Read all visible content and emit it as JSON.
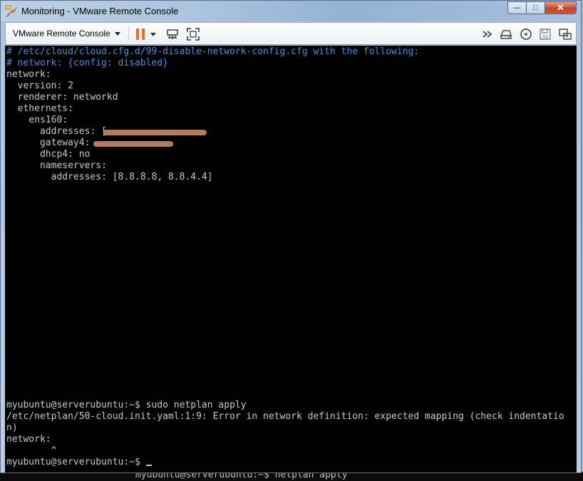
{
  "window": {
    "title": "Monitoring - VMware Remote Console",
    "controls": {
      "minimize": "—",
      "maximize": "□",
      "close": "✕"
    }
  },
  "toolbar": {
    "menu_label": "VMware Remote Console",
    "icons": [
      "pause-icon",
      "dropdown-caret-icon",
      "network-adapter-icon",
      "fullscreen-icon",
      "send-keys-icon",
      "hard-disk-icon",
      "cd-rom-icon",
      "floppy-icon",
      "usb-icon"
    ],
    "accent": "#f26b1d"
  },
  "terminal": {
    "lines": [
      "# /etc/cloud/cloud.cfg.d/99-disable-network-config.cfg with the following:",
      "# network: {config: disabled}",
      "network:",
      "  version: 2",
      "  renderer: networkd",
      "  ethernets:",
      "    ens160:",
      "      addresses: [",
      "      gateway4:",
      "      dhcp4: no",
      "      nameservers:",
      "        addresses: [8.8.8.8, 8.8.4.4]"
    ],
    "output": [
      "myubuntu@serverubuntu:~$ sudo netplan apply",
      "/etc/netplan/50-cloud.init.yaml:1:9: Error in network definition: expected mapping (check indentatio",
      "n)",
      "network:",
      "        ^",
      "",
      "myubuntu@serverubuntu:~$ "
    ],
    "colors": {
      "comment": "#4f8fd8",
      "text": "#c9c9c9",
      "background": "#000000"
    }
  },
  "background": {
    "partial_text": "myubuntu@serverubuntu:~$ netplan apply"
  }
}
